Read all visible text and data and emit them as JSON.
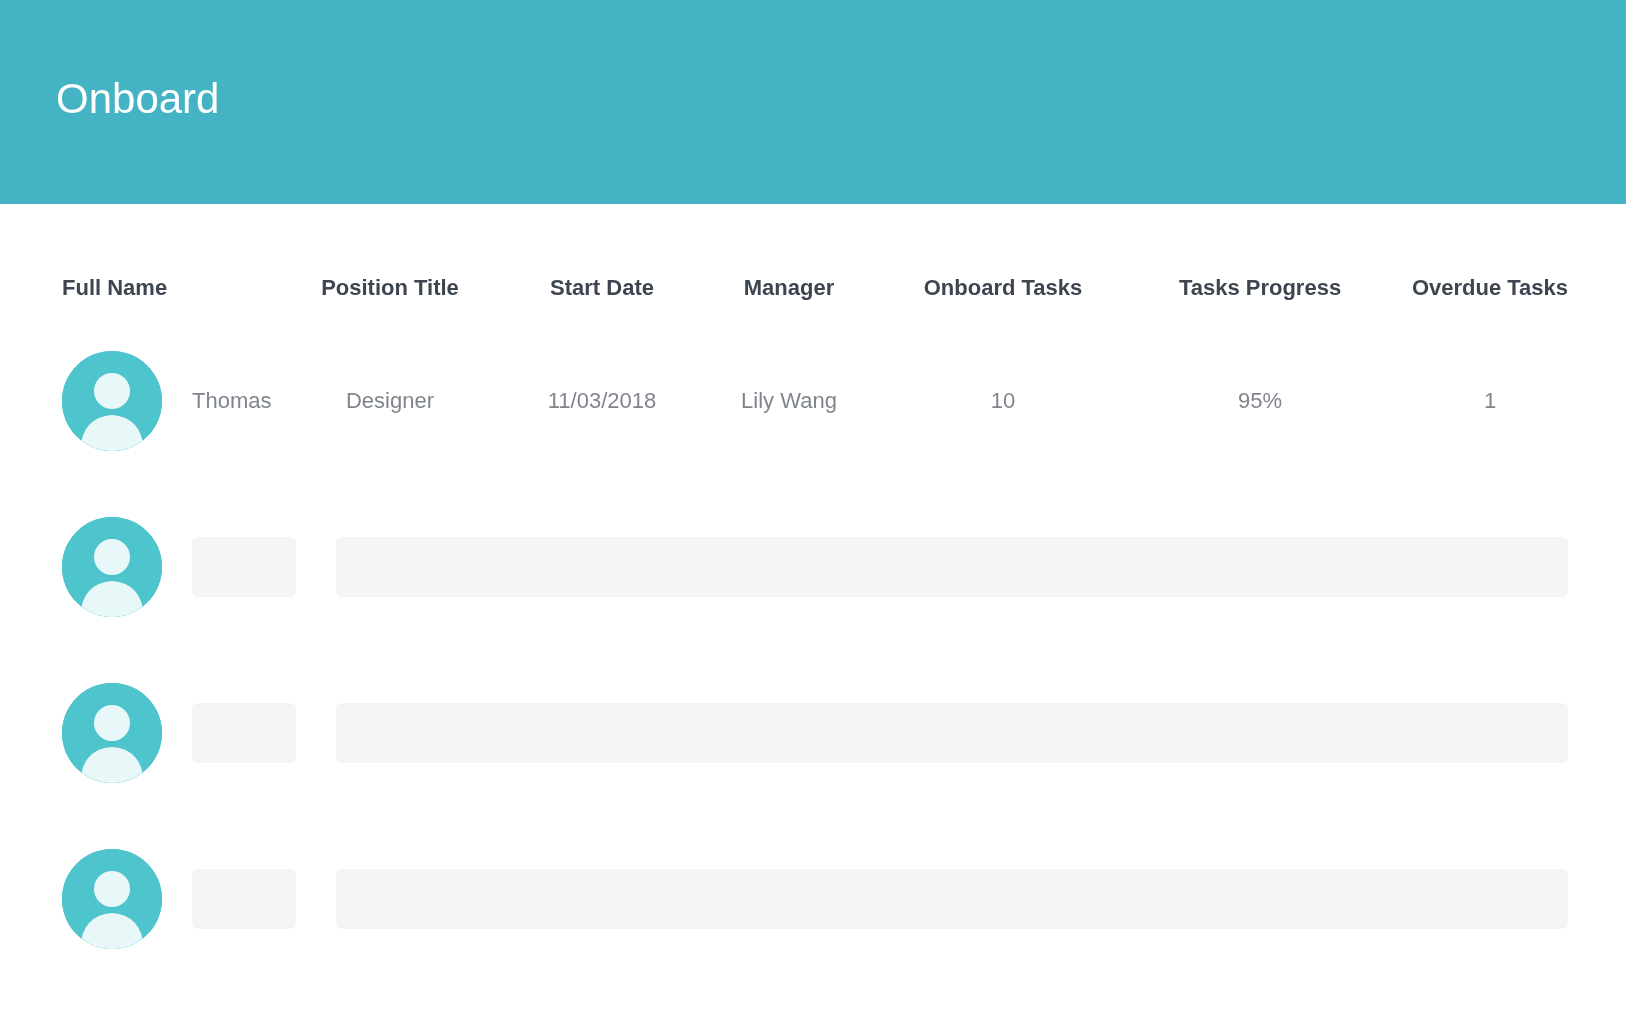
{
  "header": {
    "title": "Onboard"
  },
  "table": {
    "columns": [
      "Full Name",
      "Position Title",
      "Start Date",
      "Manager",
      "Onboard Tasks",
      "Tasks Progress",
      "Overdue Tasks"
    ],
    "rows": [
      {
        "kind": "loaded",
        "cells": [
          "Thomas",
          "Designer",
          "11/03/2018",
          "Lily Wang",
          "10",
          "95%",
          "1"
        ]
      },
      {
        "kind": "loading"
      },
      {
        "kind": "loading"
      },
      {
        "kind": "loading"
      }
    ]
  }
}
